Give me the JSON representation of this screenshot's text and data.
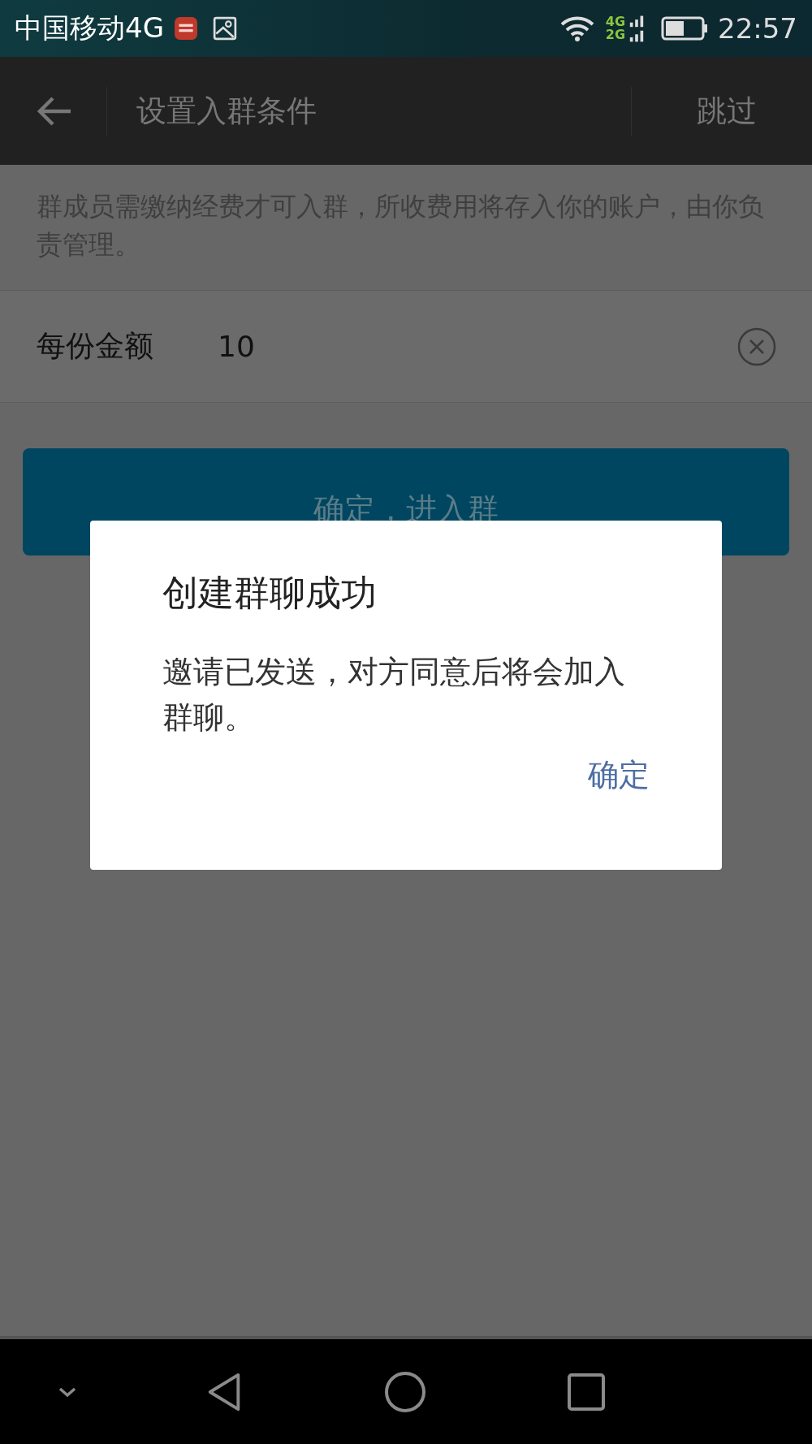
{
  "status_bar": {
    "carrier": "中国移动4G",
    "network_top": "4G",
    "network_bottom": "2G",
    "time": "22:57"
  },
  "header": {
    "title": "设置入群条件",
    "action": "跳过"
  },
  "notice": "群成员需缴纳经费才可入群，所收费用将存入你的账户，由你负责管理。",
  "amount": {
    "label": "每份金额",
    "value": "10"
  },
  "primary_button": "确定，进入群",
  "dialog": {
    "title": "创建群聊成功",
    "message": "邀请已发送，对方同意后将会加入群聊。",
    "button": "确定"
  }
}
